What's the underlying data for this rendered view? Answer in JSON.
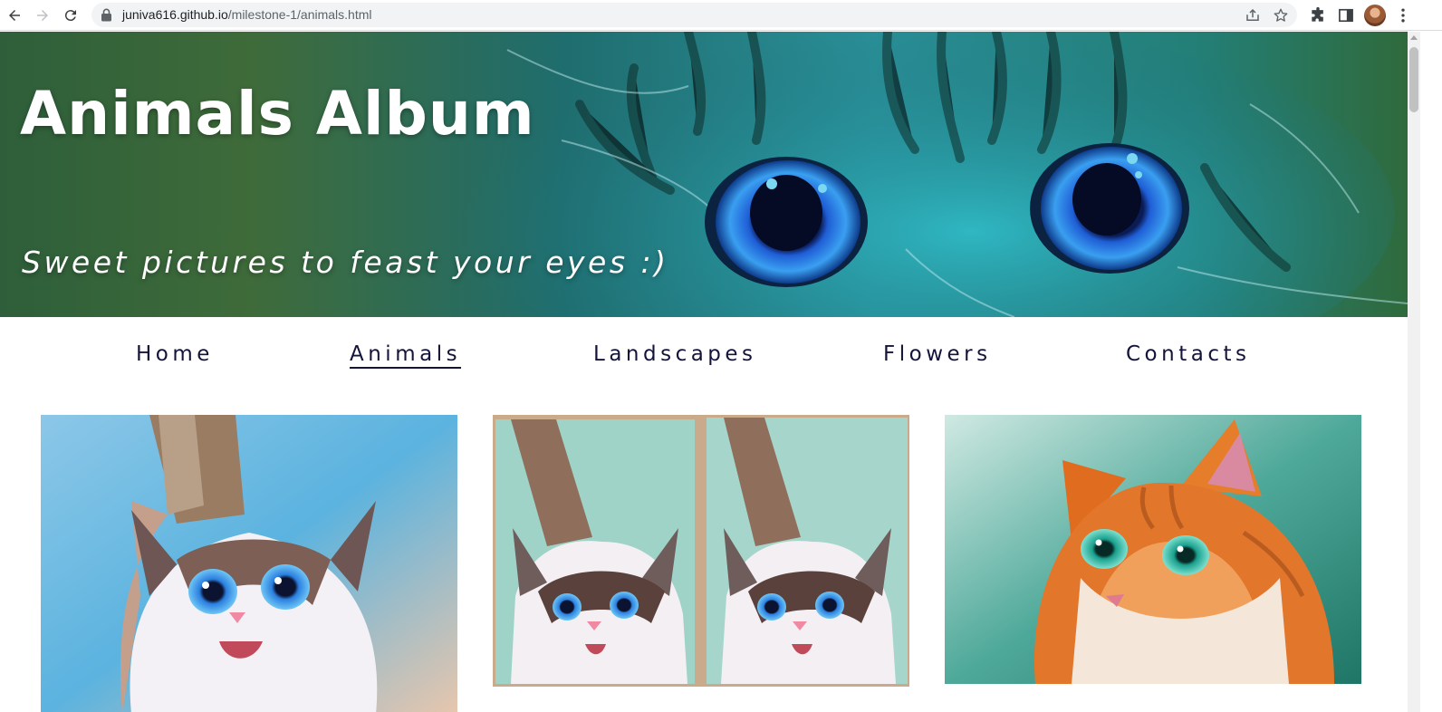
{
  "browser": {
    "url_host": "juniva616.github.io",
    "url_path": "/milestone-1/animals.html",
    "icons": [
      "back-arrow-icon",
      "forward-arrow-icon",
      "reload-icon",
      "lock-icon",
      "share-icon",
      "star-icon",
      "extensions-puzzle-icon",
      "side-panel-icon",
      "profile-avatar",
      "more-vert-icon"
    ]
  },
  "hero": {
    "title": "Animals Album",
    "subtitle": "Sweet pictures to feast your eyes :)"
  },
  "nav": {
    "items": [
      {
        "label": "Home",
        "active": false
      },
      {
        "label": "Animals",
        "active": true
      },
      {
        "label": "Landscapes",
        "active": false
      },
      {
        "label": "Flowers",
        "active": false
      },
      {
        "label": "Contacts",
        "active": false
      }
    ]
  },
  "gallery": {
    "cards": [
      {
        "image": "ragdoll-kitten-painting",
        "caption": ""
      },
      {
        "image": "two-ragdoll-kitten-canvases",
        "caption": ""
      },
      {
        "image": "ginger-cat-painting",
        "caption": ""
      }
    ]
  },
  "colors": {
    "nav_text": "#14143a",
    "hero_bg": "#1f6a62",
    "eye_blue": "#2f78d6"
  }
}
